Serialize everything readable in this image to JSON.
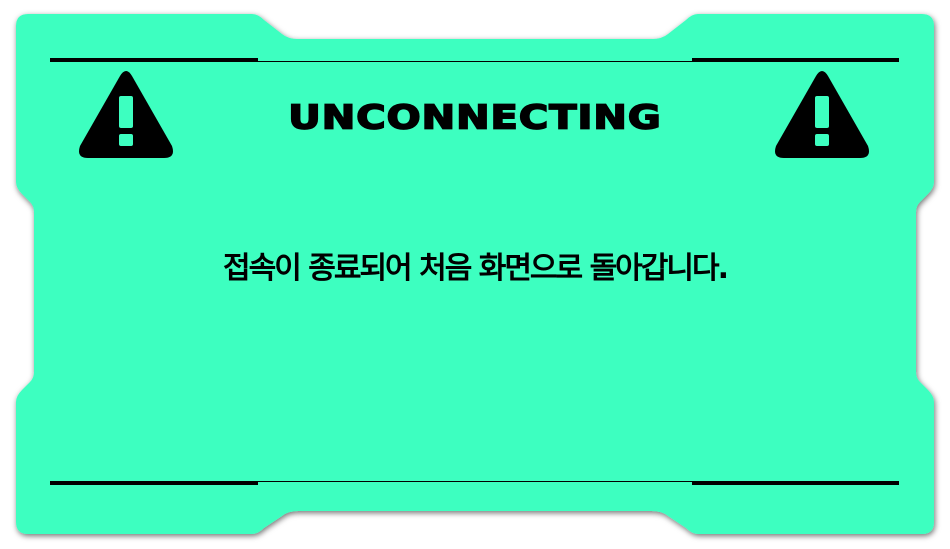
{
  "dialog": {
    "title": "UNCONNECTING",
    "message": "접속이 종료되어 처음 화면으로 돌아갑니다."
  },
  "icons": {
    "left": "warning-triangle-icon",
    "right": "warning-triangle-icon"
  },
  "colors": {
    "panel": "#3dffc0",
    "ink": "#000000",
    "shadow": "#7a7a7a"
  }
}
